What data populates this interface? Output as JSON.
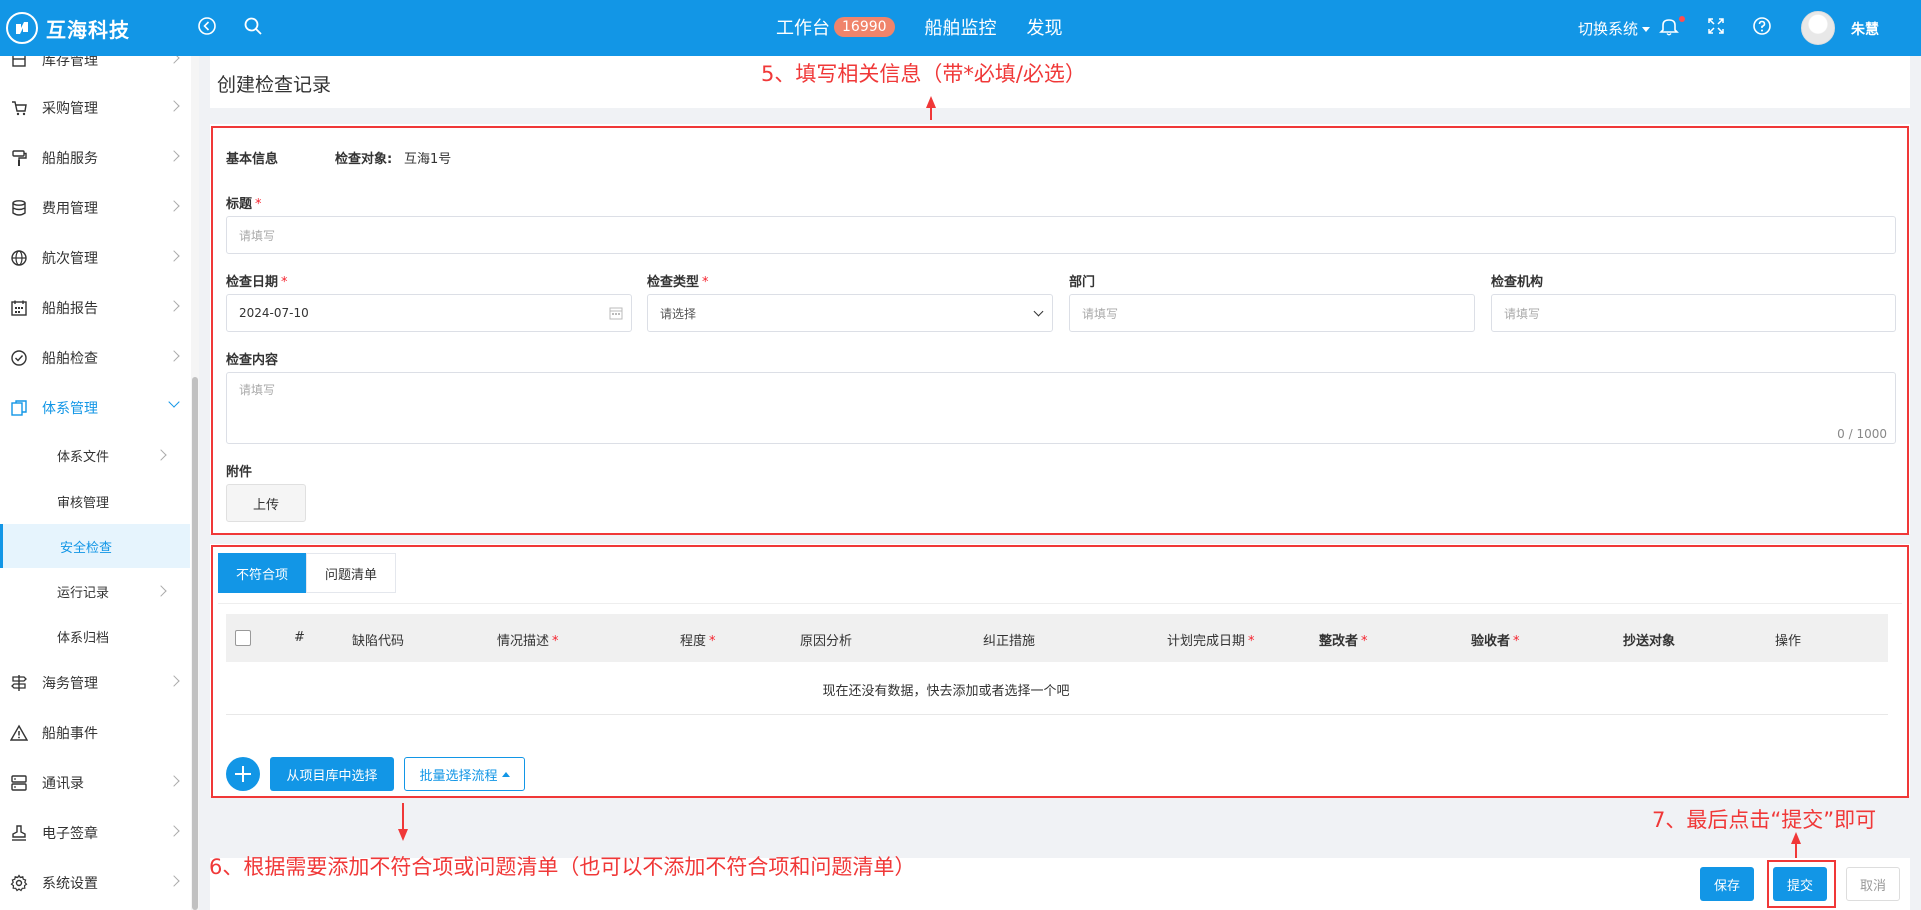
{
  "header": {
    "brand": "互海科技",
    "nav": [
      {
        "label": "工作台",
        "badge": "16990"
      },
      {
        "label": "船舶监控"
      },
      {
        "label": "发现"
      }
    ],
    "switch_system": "切换系统",
    "username": "朱慧"
  },
  "sidebar": {
    "items": [
      {
        "label": "库存管理",
        "icon": "box-icon"
      },
      {
        "label": "采购管理",
        "icon": "cart-icon"
      },
      {
        "label": "船舶服务",
        "icon": "paint-roller-icon"
      },
      {
        "label": "费用管理",
        "icon": "coins-icon"
      },
      {
        "label": "航次管理",
        "icon": "globe-icon"
      },
      {
        "label": "船舶报告",
        "icon": "calendar-icon"
      },
      {
        "label": "船舶检查",
        "icon": "check-circle-icon"
      },
      {
        "label": "体系管理",
        "icon": "documents-icon"
      },
      {
        "label": "海务管理",
        "icon": "signpost-icon"
      },
      {
        "label": "船舶事件",
        "icon": "warning-icon"
      },
      {
        "label": "通讯录",
        "icon": "server-icon"
      },
      {
        "label": "电子签章",
        "icon": "stamp-icon"
      },
      {
        "label": "系统设置",
        "icon": "gear-icon"
      }
    ],
    "sub_items": [
      {
        "label": "体系文件"
      },
      {
        "label": "审核管理"
      },
      {
        "label": "安全检查"
      },
      {
        "label": "运行记录"
      },
      {
        "label": "体系归档"
      }
    ]
  },
  "page": {
    "title": "创建检查记录",
    "basic_info": "基本信息",
    "check_object_label": "检查对象:",
    "check_object_value": "互海1号",
    "title_label": "标题",
    "title_placeholder": "请填写",
    "check_date_label": "检查日期",
    "check_date_value": "2024-07-10",
    "check_type_label": "检查类型",
    "check_type_placeholder": "请选择",
    "dept_label": "部门",
    "dept_placeholder": "请填写",
    "org_label": "检查机构",
    "org_placeholder": "请填写",
    "content_label": "检查内容",
    "content_placeholder": "请填写",
    "content_counter": "0 / 1000",
    "attachment_label": "附件",
    "upload_label": "上传"
  },
  "tabs": [
    {
      "label": "不符合项"
    },
    {
      "label": "问题清单"
    }
  ],
  "table": {
    "columns": [
      "#",
      "缺陷代码",
      "情况描述",
      "程度",
      "原因分析",
      "纠正措施",
      "计划完成日期",
      "整改者",
      "验收者",
      "抄送对象",
      "操作"
    ],
    "empty_text": "现在还没有数据，快去添加或者选择一个吧"
  },
  "actions": {
    "from_library": "从项目库中选择",
    "batch_flow": "批量选择流程",
    "save": "保存",
    "submit": "提交",
    "cancel": "取消"
  },
  "annotations": {
    "step5": "5、填写相关信息（带*必填/必选）",
    "step6": "6、根据需要添加不符合项或问题清单（也可以不添加不符合项和问题清单）",
    "step7": "7、最后点击“提交”即可"
  },
  "colors": {
    "primary": "#1296e6",
    "annotation": "#f03838",
    "badge": "#f0846b"
  }
}
